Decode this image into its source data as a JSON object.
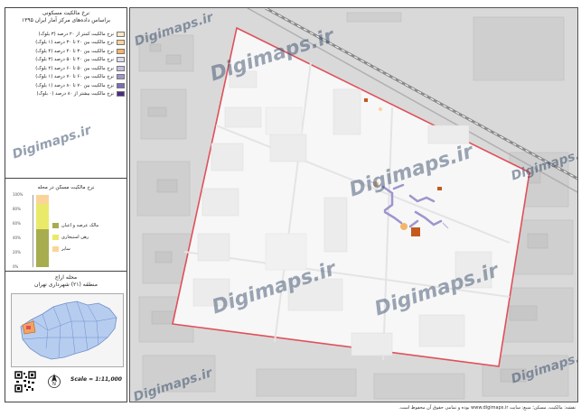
{
  "legend": {
    "title_line1": "نرخ مالکیت مسکونی",
    "title_line2": "براساس داده‌های مرکز آمار ایران ۱۳۹۵",
    "items": [
      {
        "label": "نرخ مالکیت کمتر از ۲۰ درصد (۳ بلوک)",
        "color": "#fde9c8"
      },
      {
        "label": "نرخ مالکیت بین ۲۰ تا ۳۰ درصد (۱ بلوک)",
        "color": "#fbd39a"
      },
      {
        "label": "نرخ مالکیت بین ۳۰ تا ۴۰ درصد (۴ بلوک)",
        "color": "#f6b46a"
      },
      {
        "label": "نرخ مالکیت بین ۴۰ تا ۵۰ درصد (۳ بلوک)",
        "color": "#dcdcf0"
      },
      {
        "label": "نرخ مالکیت بین ۵۰ تا ۶۰ درصد (۲ بلوک)",
        "color": "#c2c0e2"
      },
      {
        "label": "نرخ مالکیت بین ۶۰ تا ۷۰ درصد (۱ بلوک)",
        "color": "#9c96cc"
      },
      {
        "label": "نرخ مالکیت بین ۷۰ تا ۸۰ درصد (۱ بلوک)",
        "color": "#7c6db5"
      },
      {
        "label": "نرخ مالکیت بیشتر از ۸۰ درصد (۰ بلوک)",
        "color": "#4b2a86"
      }
    ]
  },
  "chart": {
    "title": "نرخ مالکیت مسکن در محله",
    "legend": [
      {
        "label": "مالک عرصه و اعیان",
        "color": "#a7ac4f"
      },
      {
        "label": "رهن استیجاری",
        "color": "#eaea6a"
      },
      {
        "label": "سایر",
        "color": "#fbd49a"
      }
    ],
    "yticks": [
      "0%",
      "20%",
      "40%",
      "60%",
      "80%",
      "100%"
    ]
  },
  "chart_data": {
    "type": "bar",
    "categories": [
      "محله"
    ],
    "series": [
      {
        "name": "مالک عرصه و اعیان",
        "values": [
          52
        ]
      },
      {
        "name": "رهن استیجاری",
        "values": [
          36
        ]
      },
      {
        "name": "سایر",
        "values": [
          12
        ]
      }
    ],
    "ylim": [
      0,
      100
    ],
    "stacked": true
  },
  "location": {
    "line1": "محله اراج",
    "line2": "منطقه (۲۱) شهرداری تهران"
  },
  "scale": "Scale = 1:11,000",
  "watermark": "Digimaps.ir",
  "footer": "نقشه: مالکیت، مسکن؛ منبع: سایت www.digimaps.ir بوده و تمامی حقوق آن محفوظ است.",
  "colors": {
    "boundary": "#e0505a",
    "site_fill": "#f7f7f7",
    "map_bg": "#d9d9d9",
    "rail": "#8a8a8a",
    "minimap_fill": "#b6cdf0"
  }
}
